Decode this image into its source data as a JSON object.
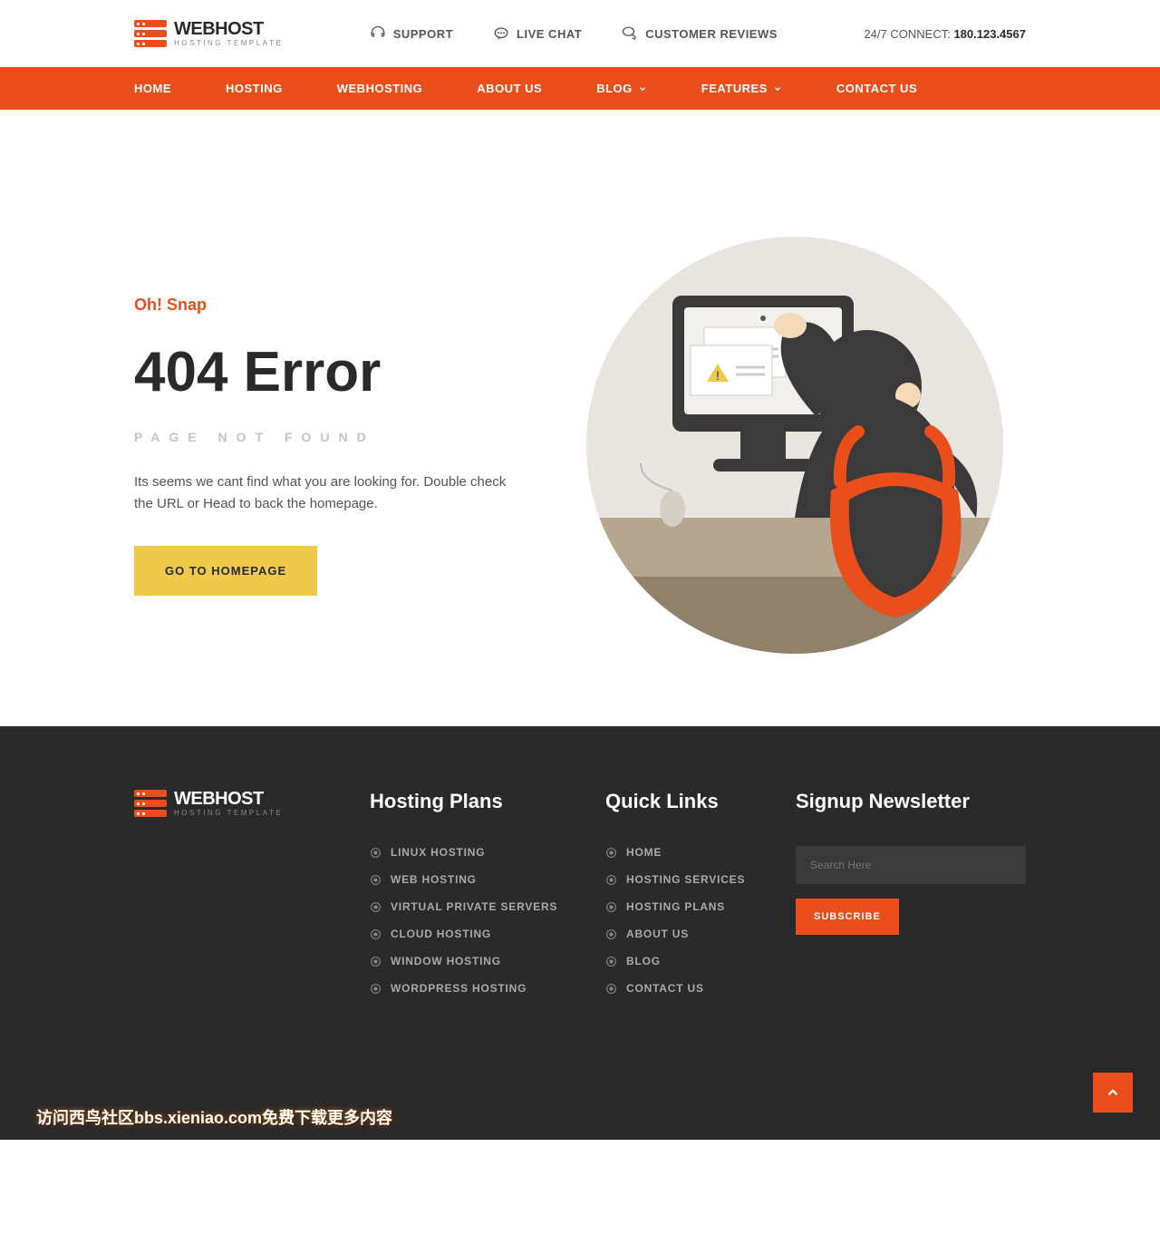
{
  "brand": {
    "title": "WEBHOST",
    "subtitle": "HOSTING TEMPLATE"
  },
  "topbar": {
    "support": "SUPPORT",
    "livechat": "LIVE CHAT",
    "reviews": "CUSTOMER REVIEWS",
    "connect_label": "24/7 CONNECT:",
    "connect_phone": "180.123.4567"
  },
  "nav": {
    "home": "HOME",
    "hosting": "HOSTING",
    "webhosting": "WEBHOSTING",
    "about": "ABOUT US",
    "blog": "BLOG",
    "features": "FEATURES",
    "contact": "CONTACT US"
  },
  "hero": {
    "eyebrow": "Oh! Snap",
    "title": "404 Error",
    "subtitle": "PAGE NOT FOUND",
    "desc": "Its seems we cant find what you are looking for. Double check the URL or Head to back the homepage.",
    "cta": "GO TO HOMEPAGE"
  },
  "footer": {
    "plans_title": "Hosting Plans",
    "plans": [
      "LINUX HOSTING",
      "WEB HOSTING",
      "VIRTUAL PRIVATE SERVERS",
      "CLOUD HOSTING",
      "WINDOW HOSTING",
      "WORDPRESS HOSTING"
    ],
    "quick_title": "Quick Links",
    "quick": [
      "HOME",
      "HOSTING SERVICES",
      "HOSTING PLANS",
      "ABOUT US",
      "BLOG",
      "CONTACT US"
    ],
    "news_title": "Signup Newsletter",
    "search_placeholder": "Search Here",
    "subscribe": "SUBSCRIBE",
    "watermark": "访问西鸟社区bbs.xieniao.com免费下载更多内容"
  }
}
